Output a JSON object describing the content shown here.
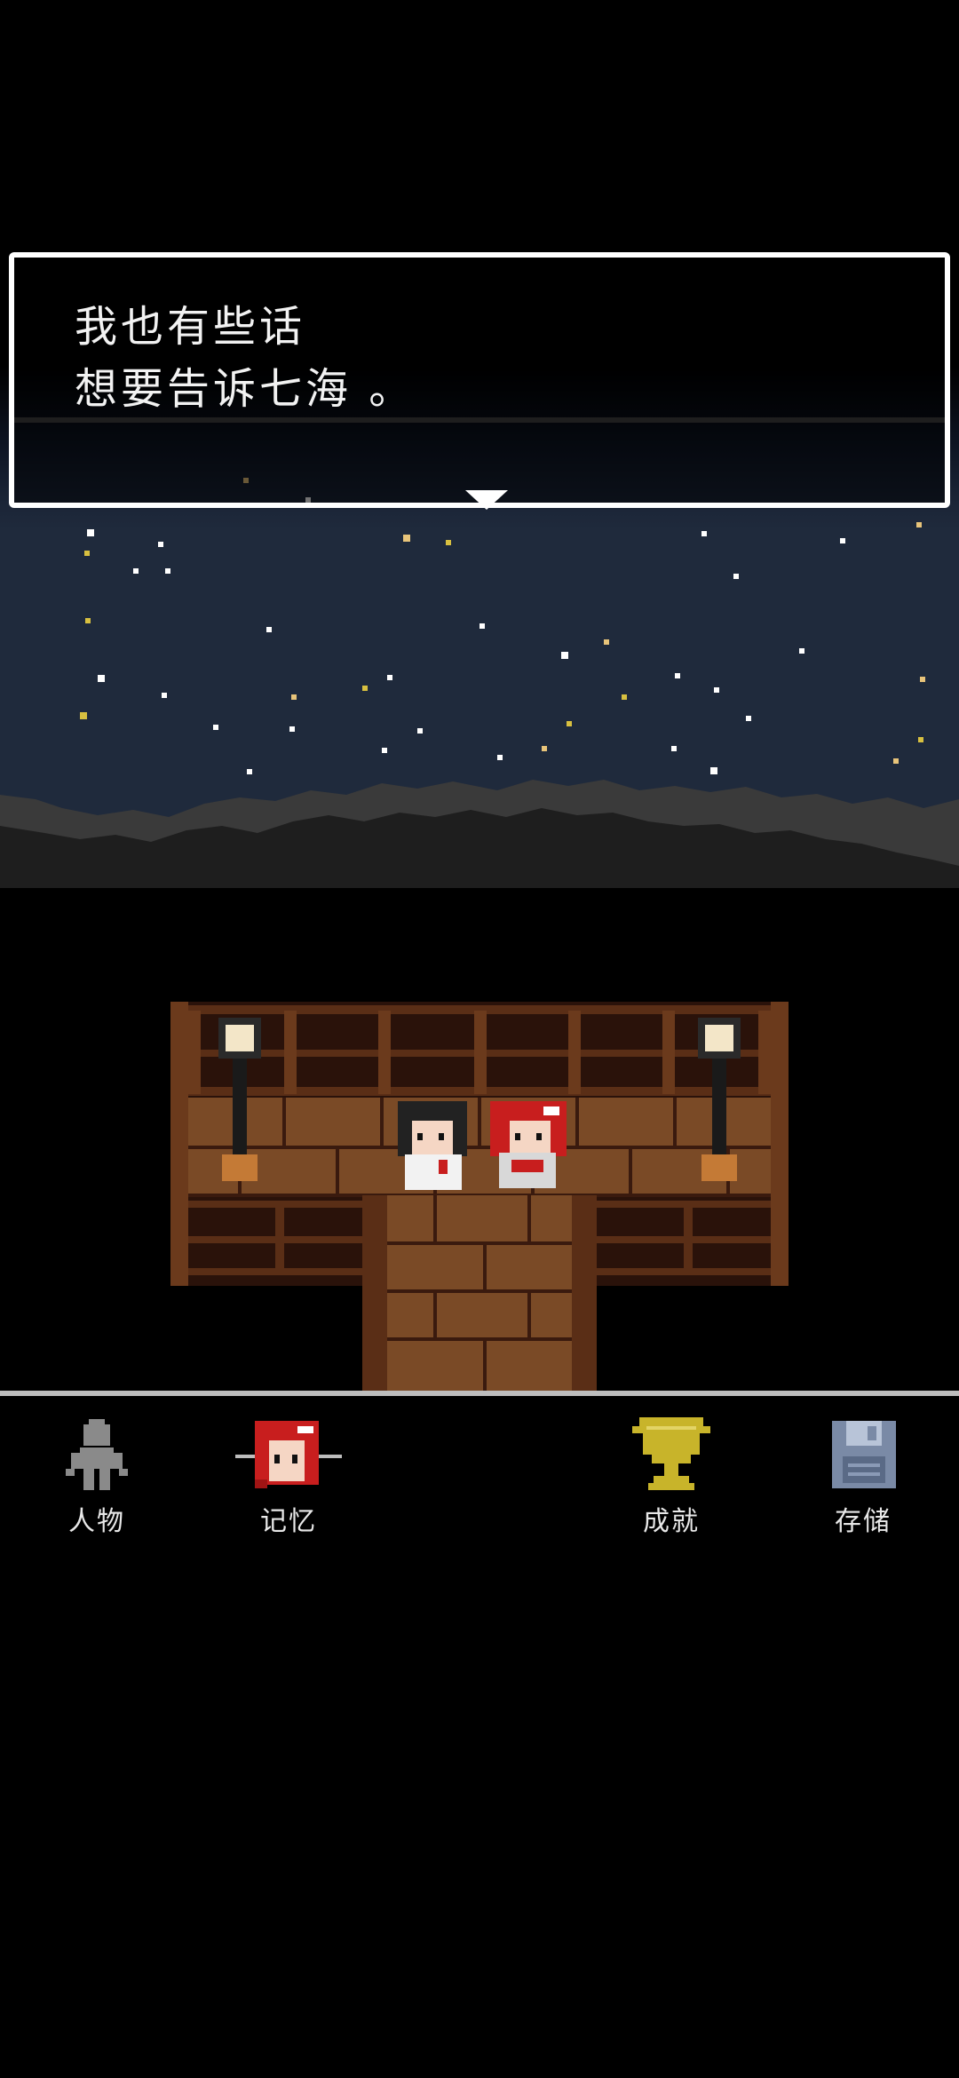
{
  "dialog": {
    "line1": "我也有些话",
    "line2": "想要告诉七海 。"
  },
  "menu": {
    "items": [
      {
        "id": "characters",
        "label": "人物",
        "icon": "person-silhouette-icon"
      },
      {
        "id": "memories",
        "label": "记忆",
        "icon": "red-haired-girl-icon"
      },
      {
        "id": "achievements",
        "label": "成就",
        "icon": "trophy-icon"
      },
      {
        "id": "save",
        "label": "存储",
        "icon": "floppy-disk-icon"
      }
    ]
  },
  "colors": {
    "sky_top": "#0a0f1c",
    "sky_bottom": "#1a2638",
    "mountain": "#2a2a2a",
    "wood_dark": "#3a1a0e",
    "wood_mid": "#6b3a1c",
    "floor": "#7a4a26",
    "trophy": "#c8b42a",
    "floppy": "#7a8aa6",
    "menu_text": "#e8e8e8"
  }
}
